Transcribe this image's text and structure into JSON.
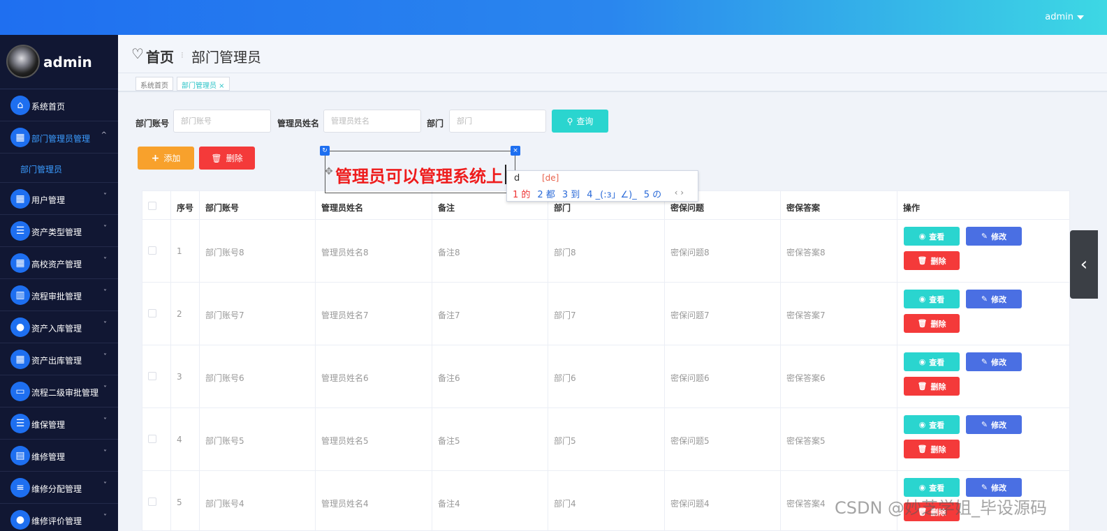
{
  "topbar": {
    "user": "admin"
  },
  "sidebar": {
    "profile_name": "admin",
    "items": [
      {
        "label": "系统首页",
        "icon": "home-icon",
        "glyph": "⌂",
        "arrow": ""
      },
      {
        "label": "部门管理员管理",
        "icon": "grid-icon",
        "glyph": "▦",
        "arrow": "^"
      },
      {
        "label": "用户管理",
        "icon": "apps-icon",
        "glyph": "▦",
        "arrow": "˅"
      },
      {
        "label": "资产类型管理",
        "icon": "list-icon",
        "glyph": "☰",
        "arrow": "˅"
      },
      {
        "label": "高校资产管理",
        "icon": "apps-icon",
        "glyph": "▦",
        "arrow": "˅"
      },
      {
        "label": "流程审批管理",
        "icon": "chart-icon",
        "glyph": "▥",
        "arrow": "˅"
      },
      {
        "label": "资产入库管理",
        "icon": "bulb-icon",
        "glyph": "●",
        "arrow": "˅"
      },
      {
        "label": "资产出库管理",
        "icon": "apps-icon",
        "glyph": "▦",
        "arrow": "˅"
      },
      {
        "label": "流程二级审批管理",
        "icon": "monitor-icon",
        "glyph": "▭",
        "arrow": "˅"
      },
      {
        "label": "维保管理",
        "icon": "list-icon",
        "glyph": "☰",
        "arrow": "˅"
      },
      {
        "label": "维修管理",
        "icon": "print-icon",
        "glyph": "▤",
        "arrow": "˅"
      },
      {
        "label": "维修分配管理",
        "icon": "sliders-icon",
        "glyph": "≡",
        "arrow": "˅"
      },
      {
        "label": "维修评价管理",
        "icon": "user-icon",
        "glyph": "●",
        "arrow": "˅"
      }
    ],
    "submenu": "部门管理员"
  },
  "header": {
    "home": "首页",
    "separator": "⁝",
    "current": "部门管理员"
  },
  "tags": [
    {
      "label": "系统首页"
    },
    {
      "label": "部门管理员 ×"
    }
  ],
  "search": {
    "account_label": "部门账号",
    "account_placeholder": "部门账号",
    "name_label": "管理员姓名",
    "name_placeholder": "管理员姓名",
    "dept_label": "部门",
    "dept_placeholder": "部门",
    "query_button": "查询"
  },
  "actions": {
    "add": "添加",
    "delete": "删除"
  },
  "table": {
    "headers": [
      "序号",
      "部门账号",
      "管理员姓名",
      "备注",
      "部门",
      "密保问题",
      "密保答案",
      "操作"
    ],
    "rows": [
      [
        "1",
        "部门账号8",
        "管理员姓名8",
        "备注8",
        "部门8",
        "密保问题8",
        "密保答案8"
      ],
      [
        "2",
        "部门账号7",
        "管理员姓名7",
        "备注7",
        "部门7",
        "密保问题7",
        "密保答案7"
      ],
      [
        "3",
        "部门账号6",
        "管理员姓名6",
        "备注6",
        "部门6",
        "密保问题6",
        "密保答案6"
      ],
      [
        "4",
        "部门账号5",
        "管理员姓名5",
        "备注5",
        "部门5",
        "密保问题5",
        "密保答案5"
      ],
      [
        "5",
        "部门账号4",
        "管理员姓名4",
        "备注4",
        "部门4",
        "密保问题4",
        "密保答案4"
      ]
    ],
    "view_label": "查看",
    "edit_label": "修改",
    "delete_label": "删除"
  },
  "annotation": {
    "text": "管理员可以管理系统上"
  },
  "ime": {
    "composition": "d",
    "pinyin": "[de]",
    "candidates": [
      "1 的",
      "2 都",
      "3 到",
      "4 _(:з」∠)_",
      "5 の"
    ],
    "nav": "‹ ›"
  },
  "watermark": "CSDN @妙芝学姐_毕设源码"
}
